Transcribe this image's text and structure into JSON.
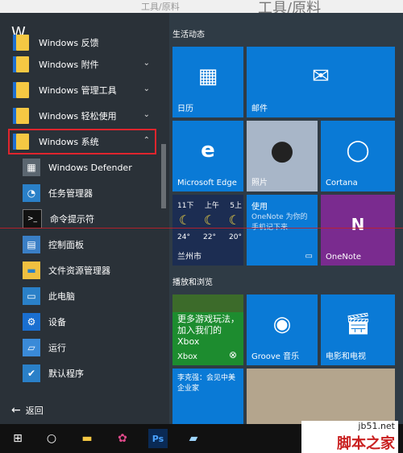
{
  "background_window": {
    "text1": "工具/原料",
    "text2": "工具/原料"
  },
  "left": {
    "letter": "W",
    "apps": [
      {
        "label": "Windows 反馈",
        "has_chevron": false
      },
      {
        "label": "Windows 附件",
        "has_chevron": true
      },
      {
        "label": "Windows 管理工具",
        "has_chevron": true
      },
      {
        "label": "Windows 轻松使用",
        "has_chevron": true
      },
      {
        "label": "Windows 系统",
        "has_chevron": true,
        "expanded": true
      }
    ],
    "subitems": [
      {
        "label": "Windows Defender",
        "icon": "defender-icon"
      },
      {
        "label": "任务管理器",
        "icon": "task-manager-icon"
      },
      {
        "label": "命令提示符",
        "icon": "cmd-icon"
      },
      {
        "label": "控制面板",
        "icon": "control-panel-icon"
      },
      {
        "label": "文件资源管理器",
        "icon": "file-explorer-icon"
      },
      {
        "label": "此电脑",
        "icon": "this-pc-icon"
      },
      {
        "label": "设备",
        "icon": "devices-icon"
      },
      {
        "label": "运行",
        "icon": "run-icon"
      },
      {
        "label": "默认程序",
        "icon": "default-programs-icon"
      }
    ],
    "back": "返回"
  },
  "right": {
    "group1": "生活动态",
    "group2": "播放和浏览",
    "tiles": {
      "calendar": "日历",
      "mail": "邮件",
      "edge": "Microsoft Edge",
      "photos": "照片",
      "cortana": "Cortana",
      "weather": {
        "days": [
          "11下",
          "上午",
          "5上"
        ],
        "temps": [
          "24°",
          "22°",
          "20°"
        ],
        "city": "兰州市"
      },
      "onenote_promo": {
        "title": "使用",
        "text": "OneNote 为你的手机记下来"
      },
      "onenote": "OneNote",
      "xbox": {
        "text": "更多游戏玩法，加入我们的 Xbox",
        "label": "Xbox"
      },
      "groove": "Groove 音乐",
      "movies": "电影和电视",
      "news": "李克强：会见中美企业家"
    }
  },
  "watermark": {
    "site": "jb51.net",
    "brand": "脚本之家"
  },
  "colors": {
    "tile_blue": "#0a7ad6",
    "selection_red": "#e0252d"
  }
}
